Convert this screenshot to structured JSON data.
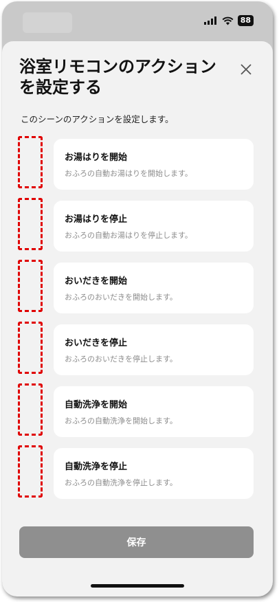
{
  "status": {
    "battery": "88"
  },
  "dialog": {
    "title": "浴室リモコンのアクションを設定する",
    "description": "このシーンのアクションを設定します。"
  },
  "actions": [
    {
      "title": "お湯はりを開始",
      "subtitle": "おふろの自動お湯はりを開始します。"
    },
    {
      "title": "お湯はりを停止",
      "subtitle": "おふろの自動お湯はりを停止します。"
    },
    {
      "title": "おいだきを開始",
      "subtitle": "おふろのおいだきを開始します。"
    },
    {
      "title": "おいだきを停止",
      "subtitle": "おふろのおいだきを停止します。"
    },
    {
      "title": "自動洗浄を開始",
      "subtitle": "おふろの自動洗浄を開始します。"
    },
    {
      "title": "自動洗浄を停止",
      "subtitle": "おふろの自動洗浄を停止します。"
    }
  ],
  "footer": {
    "save_label": "保存"
  },
  "colors": {
    "sheet_bg": "#f2f2f2",
    "card_bg": "#ffffff",
    "button_bg": "#8f8f8f",
    "highlight": "#e00000"
  }
}
